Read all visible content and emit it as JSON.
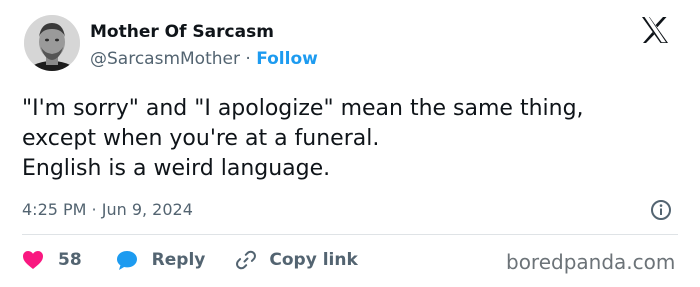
{
  "author": {
    "name": "Mother Of Sarcasm",
    "handle": "@SarcasmMother",
    "separator": "·",
    "follow_label": "Follow"
  },
  "tweet": {
    "lines": [
      "\"I'm sorry\" and \"I apologize\" mean the same thing,",
      "except when you're at a funeral.",
      "English is a weird language."
    ],
    "timestamp": "4:25 PM · Jun 9, 2024"
  },
  "actions": {
    "like_count": "58",
    "reply_label": "Reply",
    "copy_label": "Copy link"
  },
  "watermark": "boredpanda.com",
  "icons": {
    "platform": "x-logo-icon",
    "like": "heart-icon",
    "reply": "speech-bubble-icon",
    "copy": "link-icon",
    "info": "info-icon"
  },
  "colors": {
    "follow": "#1d9bf0",
    "heart": "#f91880",
    "reply_bubble": "#1d9bf0",
    "secondary_text": "#536471"
  }
}
